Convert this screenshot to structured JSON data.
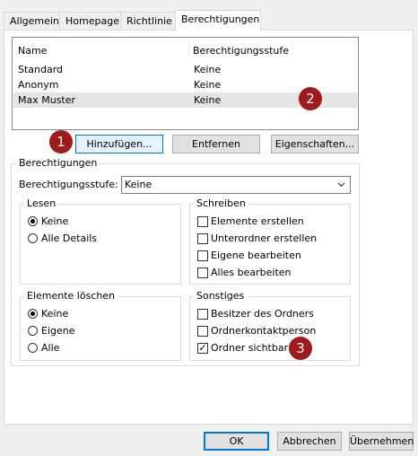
{
  "tabs": [
    "Allgemein",
    "Homepage",
    "Richtlinie",
    "Berechtigungen"
  ],
  "list": {
    "headers": [
      "Name",
      "Berechtigungsstufe"
    ],
    "rows": [
      {
        "name": "Standard",
        "level": "Keine"
      },
      {
        "name": "Anonym",
        "level": "Keine"
      },
      {
        "name": "Max Muster",
        "level": "Keine"
      }
    ]
  },
  "actions": {
    "add": "Hinzufügen...",
    "remove": "Entfernen",
    "properties": "Eigenschaften..."
  },
  "permissions": {
    "title": "Berechtigungen",
    "level_label": "Berechtigungsstufe:",
    "level_value": "Keine",
    "read": {
      "title": "Lesen",
      "options": [
        "Keine",
        "Alle Details"
      ]
    },
    "write": {
      "title": "Schreiben",
      "options": [
        "Elemente erstellen",
        "Unterordner erstellen",
        "Eigene bearbeiten",
        "Alles bearbeiten"
      ]
    },
    "delete": {
      "title": "Elemente löschen",
      "options": [
        "Keine",
        "Eigene",
        "Alle"
      ]
    },
    "other": {
      "title": "Sonstiges",
      "options": [
        "Besitzer des Ordners",
        "Ordnerkontaktperson",
        "Ordner sichtbar"
      ]
    }
  },
  "footer": {
    "ok": "OK",
    "cancel": "Abbrechen",
    "apply": "Übernehmen"
  },
  "callouts": [
    "1",
    "2",
    "3"
  ],
  "colors": {
    "accent": "#0078d7",
    "callout": "#9f1a1a",
    "selected_row": "#e5e5e5"
  },
  "icons": {
    "dropdown": "chevron-down-icon",
    "checked": "checkmark-icon"
  }
}
